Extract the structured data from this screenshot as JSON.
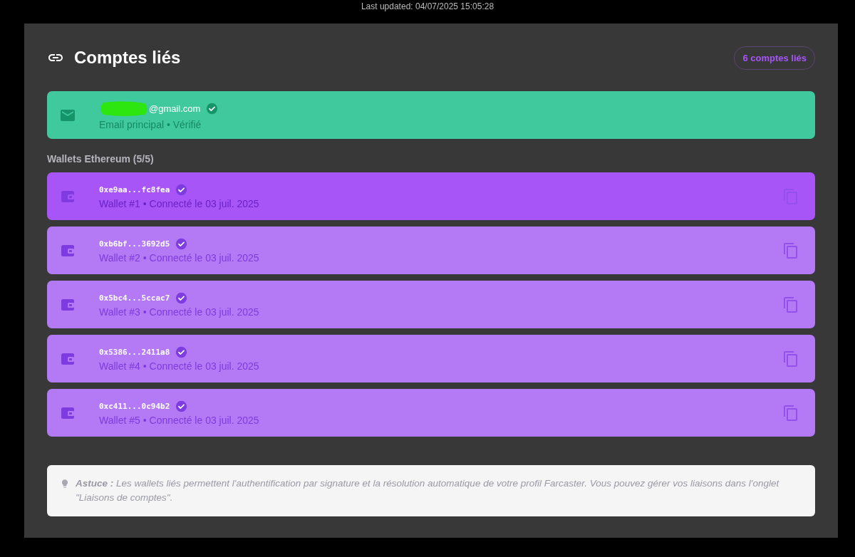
{
  "last_updated": "Last updated: 04/07/2025 15:05:28",
  "title": "Comptes liés",
  "count_badge": "6 comptes liés",
  "email": {
    "address": "@gmail.com",
    "redacted": true,
    "verified": true,
    "subtitle": "Email principal • Vérifié"
  },
  "wallets_heading": "Wallets Ethereum (5/5)",
  "wallets": [
    {
      "address": "0xe9aa...fc8fea",
      "verified": true,
      "subtitle": "Wallet #1 • Connecté le 03 juil. 2025",
      "selected": true
    },
    {
      "address": "0xb6bf...3692d5",
      "verified": true,
      "subtitle": "Wallet #2 • Connecté le 03 juil. 2025",
      "selected": false
    },
    {
      "address": "0x5bc4...5ccac7",
      "verified": true,
      "subtitle": "Wallet #3 • Connecté le 03 juil. 2025",
      "selected": false
    },
    {
      "address": "0x5386...2411a8",
      "verified": true,
      "subtitle": "Wallet #4 • Connecté le 03 juil. 2025",
      "selected": false
    },
    {
      "address": "0xc411...0c94b2",
      "verified": true,
      "subtitle": "Wallet #5 • Connecté le 03 juil. 2025",
      "selected": false
    }
  ],
  "tip": "**Astuce :** Les wallets liés permettent l'authentification par signature et la résolution automatique de votre profil Farcaster. Vous pouvez gérer vos liaisons dans l'onglet \"Liaisons de comptes\"."
}
